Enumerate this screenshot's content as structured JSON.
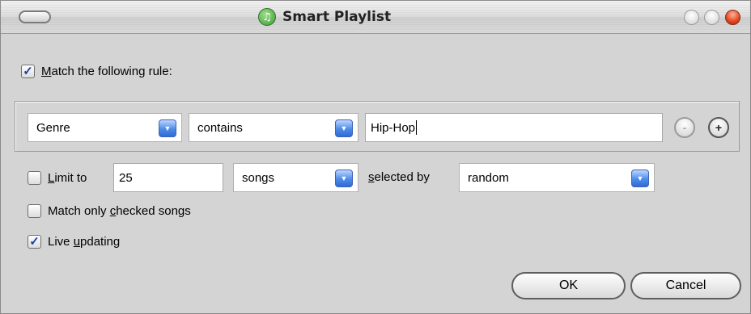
{
  "window": {
    "title": "Smart Playlist"
  },
  "match_rule": {
    "label_prefix": "",
    "label_u": "M",
    "label_rest": "atch the following rule:",
    "checked": true
  },
  "rule": {
    "field": "Genre",
    "operator": "contains",
    "value": "Hip-Hop",
    "remove_label": "-",
    "add_label": "+"
  },
  "limit": {
    "label_u": "L",
    "label_rest": "imit to",
    "checked": false,
    "amount": "25",
    "unit": "songs",
    "selected_by_u": "s",
    "selected_by_rest": "elected by",
    "method": "random"
  },
  "match_checked": {
    "label_a": "Match only ",
    "label_u": "c",
    "label_b": "hecked songs",
    "checked": false
  },
  "live_updating": {
    "label_a": "Live ",
    "label_u": "u",
    "label_b": "pdating",
    "checked": true
  },
  "buttons": {
    "ok": "OK",
    "cancel": "Cancel"
  }
}
